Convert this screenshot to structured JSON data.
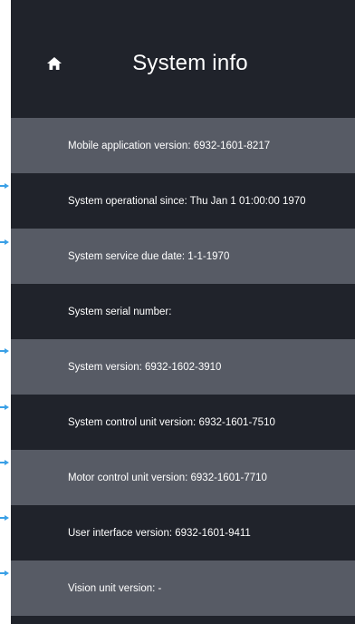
{
  "header": {
    "title": "System info",
    "home_icon": "home-icon"
  },
  "colors": {
    "background_dark": "#20232b",
    "row_light": "#575b65",
    "text": "#ffffff",
    "marker": "#3aa0e6"
  },
  "rows": [
    {
      "text": "Mobile application version: 6932-1601-8217"
    },
    {
      "text": "System operational since: Thu Jan  1 01:00:00 1970"
    },
    {
      "text": "System service due date: 1-1-1970"
    },
    {
      "text": "System serial number:"
    },
    {
      "text": "System version: 6932-1602-3910"
    },
    {
      "text": "System control unit version: 6932-1601-7510"
    },
    {
      "text": "Motor control unit version: 6932-1601-7710"
    },
    {
      "text": "User interface version: 6932-1601-9411"
    },
    {
      "text": "Vision unit version: -"
    }
  ]
}
